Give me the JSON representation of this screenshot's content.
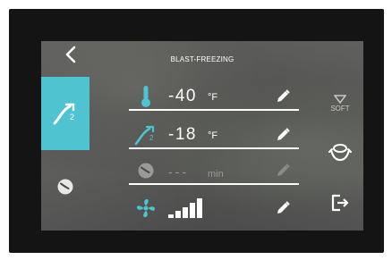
{
  "header": {
    "title": "BLAST-FREEZING"
  },
  "icons": {
    "back": "chevron-left-icon",
    "core_probe": "core-probe-icon",
    "timer": "clock-icon",
    "thermometer": "thermometer-icon",
    "fan": "fan-icon",
    "edit": "pencil-icon",
    "soft": "triangle-down-icon",
    "hold": "hold-icon",
    "exit": "exit-icon"
  },
  "rows": {
    "chamber_temp": {
      "value": "-40",
      "unit": "°F"
    },
    "probe_temp": {
      "value": "-18",
      "unit": "°F"
    },
    "time": {
      "value": "---",
      "unit": "min"
    },
    "fan": {
      "level": "5 of 5 bars"
    }
  },
  "right_panel": {
    "soft_label": "SOFT"
  },
  "colors": {
    "accent": "#4fc3d0",
    "text": "#ffffff",
    "disabled": "#9a9a9a"
  }
}
